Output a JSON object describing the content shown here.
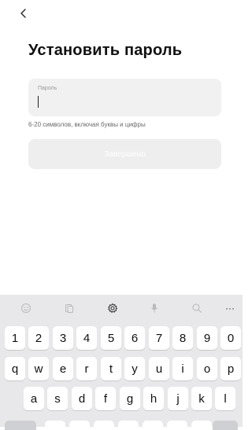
{
  "page": {
    "title": "Установить пароль",
    "password_field": {
      "label": "Пароль",
      "value": ""
    },
    "hint": "6-20 символов, включая буквы и цифры",
    "submit_label": "Завершено"
  },
  "keyboard": {
    "toolbar_icons": [
      "emoji-icon",
      "clipboard-icon",
      "settings-gear-icon",
      "microphone-icon",
      "search-icon",
      "more-icon"
    ],
    "toolbar_more": "···",
    "row_numbers": [
      "1",
      "2",
      "3",
      "4",
      "5",
      "6",
      "7",
      "8",
      "9",
      "0"
    ],
    "row_top": [
      "q",
      "w",
      "e",
      "r",
      "t",
      "y",
      "u",
      "i",
      "o",
      "p"
    ],
    "row_middle": [
      "a",
      "s",
      "d",
      "f",
      "g",
      "h",
      "j",
      "k",
      "l"
    ]
  }
}
